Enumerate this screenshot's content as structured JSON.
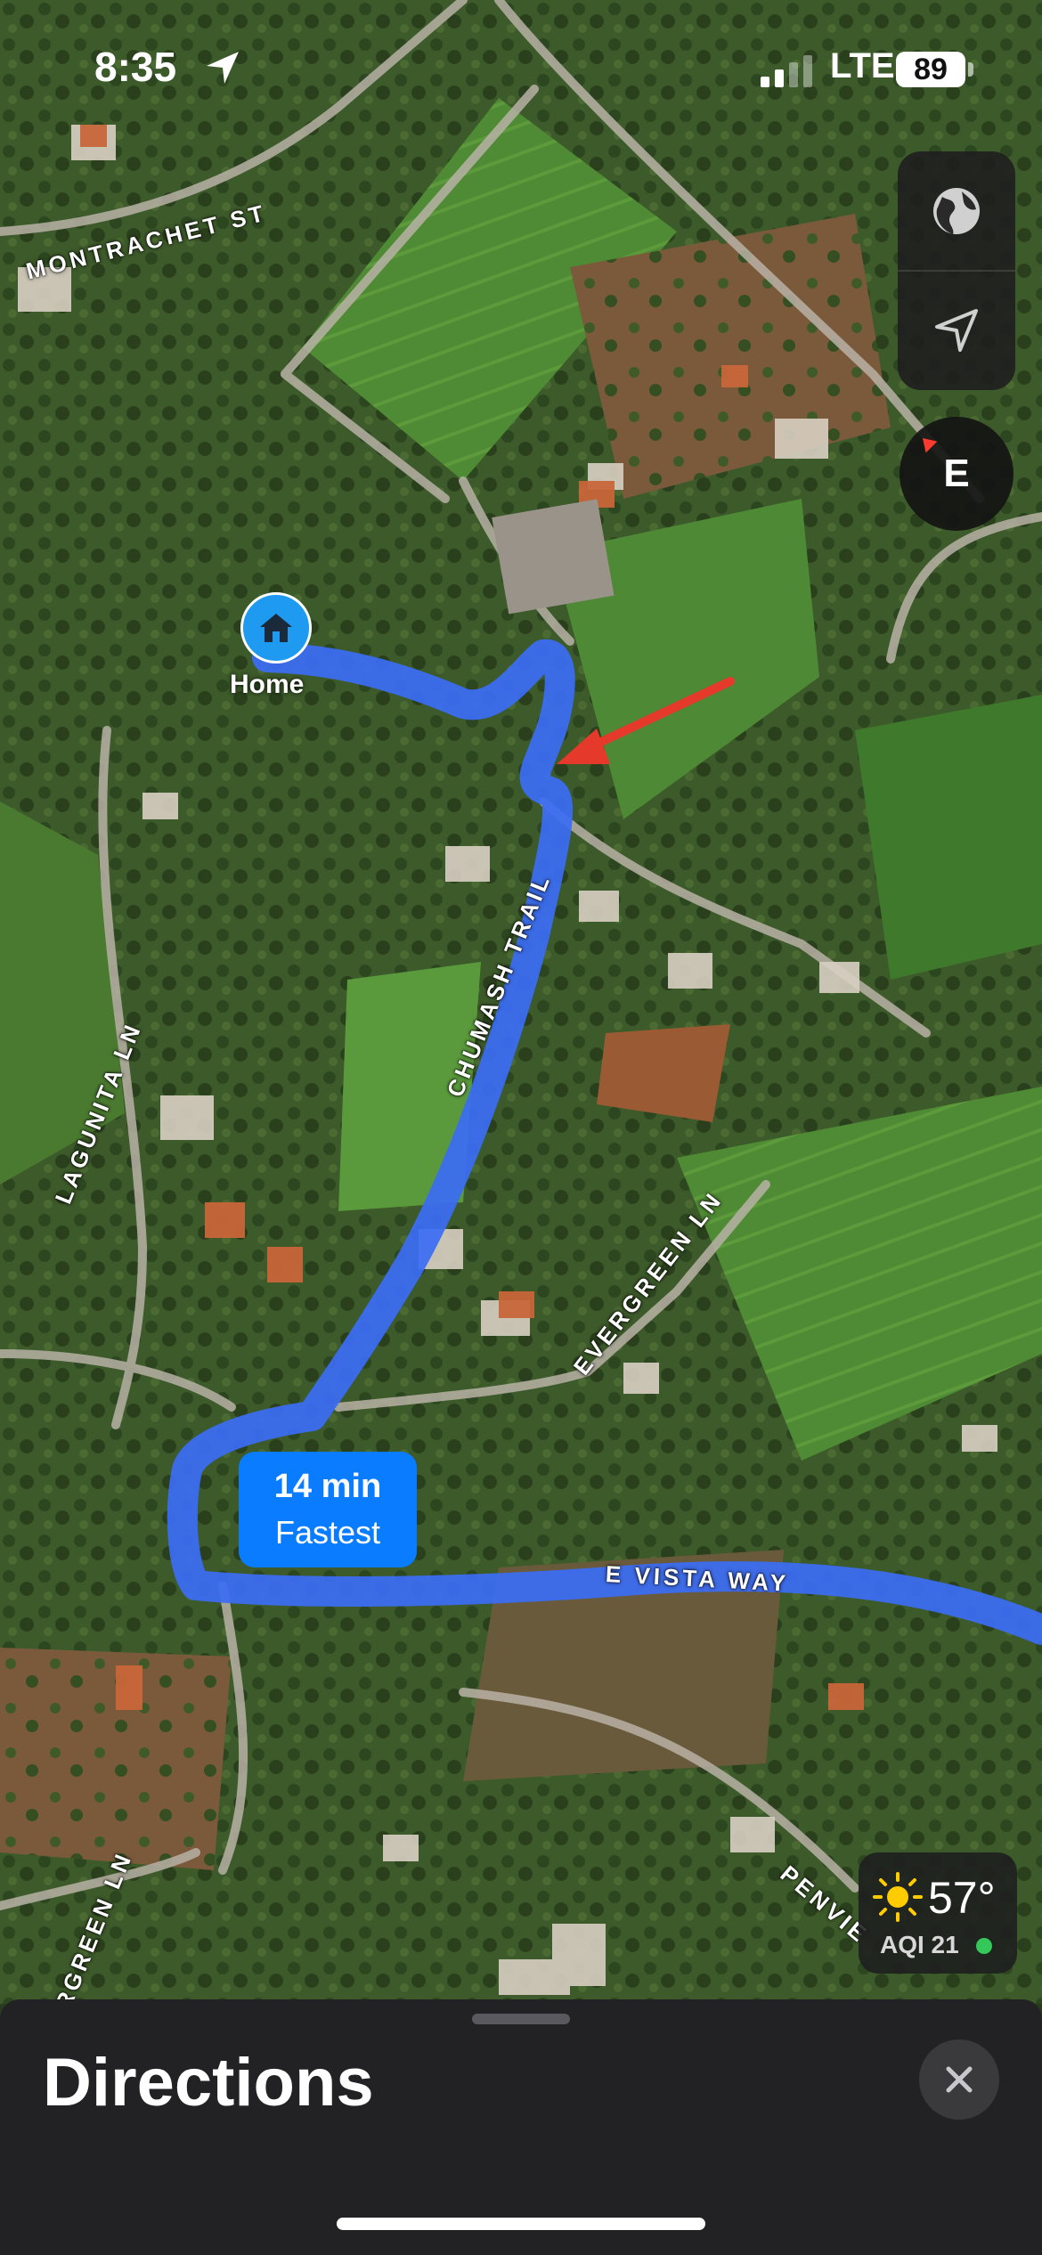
{
  "status_bar": {
    "time": "8:35",
    "carrier": "LTE",
    "battery": "89"
  },
  "map": {
    "streets": [
      "MONTRACHET ST",
      "CHUMASH TRAIL",
      "LAGUNITA LN",
      "EVERGREEN LN",
      "E VISTA WAY",
      "PENVIE",
      "RGREEN LN"
    ],
    "home_label": "Home",
    "route": {
      "time": "14 min",
      "subtitle": "Fastest",
      "color": "#3b6cf5"
    },
    "annotation_arrow_color": "#e5392b"
  },
  "controls": {
    "globe_icon": "globe-icon",
    "locate_icon": "location-arrow-icon",
    "compass_heading": "E"
  },
  "weather": {
    "temperature": "57°",
    "aqi": "AQI 21",
    "aqi_color": "#34c759"
  },
  "sheet": {
    "title": "Directions",
    "close_icon": "close-icon"
  }
}
